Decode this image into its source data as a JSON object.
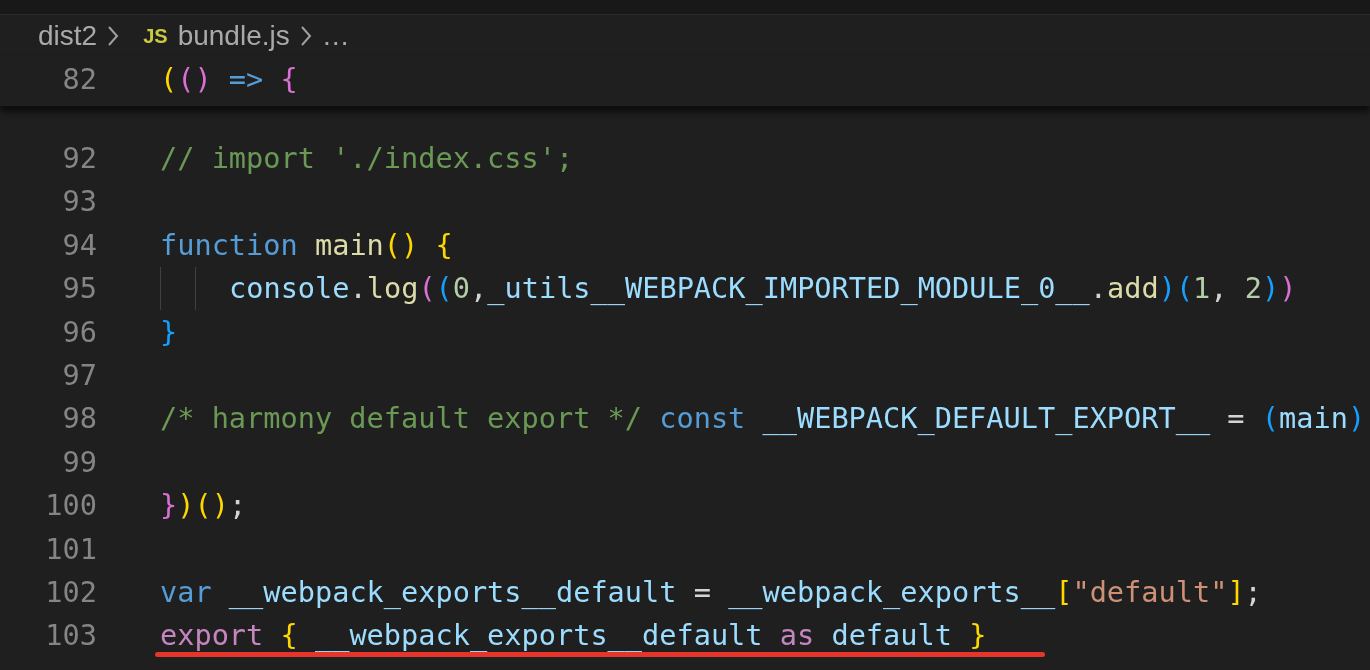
{
  "breadcrumb": [
    {
      "text": "dist2"
    },
    {
      "text": "bundle.js",
      "badge": "JS"
    },
    {
      "text": "…"
    }
  ],
  "sticky_line": {
    "number": "82",
    "tokens": [
      {
        "text": "(",
        "kind": "b1"
      },
      {
        "text": "()",
        "kind": "b2"
      },
      {
        "text": " =>",
        "kind": "kw"
      },
      {
        "text": " {",
        "kind": "b2"
      }
    ]
  },
  "lines": [
    {
      "number": "92",
      "indented": false,
      "underlined": false,
      "tokens": [
        {
          "text": "// import './index.css';",
          "kind": "comment"
        }
      ]
    },
    {
      "number": "93",
      "indented": false,
      "underlined": false
    },
    {
      "number": "94",
      "indented": false,
      "underlined": false,
      "tokens": [
        {
          "text": "function",
          "kind": "kw"
        },
        {
          "text": " main",
          "kind": "fn"
        },
        {
          "text": "()",
          "kind": "b1"
        },
        {
          "text": " {",
          "kind": "b1"
        }
      ]
    },
    {
      "number": "95",
      "indented": true,
      "underlined": false,
      "tokens": [
        {
          "text": "console",
          "kind": "var"
        },
        {
          "text": ".",
          "kind": "p"
        },
        {
          "text": "log",
          "kind": "fn"
        },
        {
          "text": "(",
          "kind": "b2"
        },
        {
          "text": "(",
          "kind": "b3"
        },
        {
          "text": "0",
          "kind": "num"
        },
        {
          "text": ",",
          "kind": "p"
        },
        {
          "text": "_utils__WEBPACK_IMPORTED_MODULE_0__",
          "kind": "var"
        },
        {
          "text": ".",
          "kind": "p"
        },
        {
          "text": "add",
          "kind": "fn"
        },
        {
          "text": ")",
          "kind": "b3"
        },
        {
          "text": "(",
          "kind": "b3"
        },
        {
          "text": "1",
          "kind": "num"
        },
        {
          "text": ", ",
          "kind": "p"
        },
        {
          "text": "2",
          "kind": "num"
        },
        {
          "text": ")",
          "kind": "b3"
        },
        {
          "text": ")",
          "kind": "b2"
        }
      ]
    },
    {
      "number": "96",
      "indented": false,
      "underlined": false,
      "tokens": [
        {
          "text": "}",
          "kind": "b3"
        }
      ]
    },
    {
      "number": "97",
      "indented": false,
      "underlined": false
    },
    {
      "number": "98",
      "indented": false,
      "underlined": false,
      "tokens": [
        {
          "text": "/* harmony default export */",
          "kind": "comment"
        },
        {
          "text": " const",
          "kind": "kw"
        },
        {
          "text": " __WEBPACK_DEFAULT_EXPORT__",
          "kind": "var"
        },
        {
          "text": " = ",
          "kind": "p"
        },
        {
          "text": "(",
          "kind": "b3"
        },
        {
          "text": "main",
          "kind": "var"
        },
        {
          "text": ")",
          "kind": "b3"
        }
      ]
    },
    {
      "number": "99",
      "indented": false,
      "underlined": false
    },
    {
      "number": "100",
      "indented": false,
      "underlined": false,
      "tokens": [
        {
          "text": "}",
          "kind": "b2"
        },
        {
          "text": ")",
          "kind": "b1"
        },
        {
          "text": "()",
          "kind": "b1"
        },
        {
          "text": ";",
          "kind": "p"
        }
      ]
    },
    {
      "number": "101",
      "indented": false,
      "underlined": false
    },
    {
      "number": "102",
      "indented": false,
      "underlined": false,
      "tokens": [
        {
          "text": "var",
          "kind": "kw"
        },
        {
          "text": " __webpack_exports__default",
          "kind": "var"
        },
        {
          "text": " = ",
          "kind": "p"
        },
        {
          "text": "__webpack_exports__",
          "kind": "var"
        },
        {
          "text": "[",
          "kind": "b1"
        },
        {
          "text": "\"default\"",
          "kind": "str"
        },
        {
          "text": "]",
          "kind": "b1"
        },
        {
          "text": ";",
          "kind": "p"
        }
      ]
    },
    {
      "number": "103",
      "indented": false,
      "underlined": true,
      "tokens": [
        {
          "text": "export",
          "kind": "ctl"
        },
        {
          "text": " {",
          "kind": "b1"
        },
        {
          "text": " __webpack_exports__default",
          "kind": "var"
        },
        {
          "text": " as",
          "kind": "ctl"
        },
        {
          "text": " default",
          "kind": "var"
        },
        {
          "text": " }",
          "kind": "b1"
        }
      ]
    }
  ]
}
